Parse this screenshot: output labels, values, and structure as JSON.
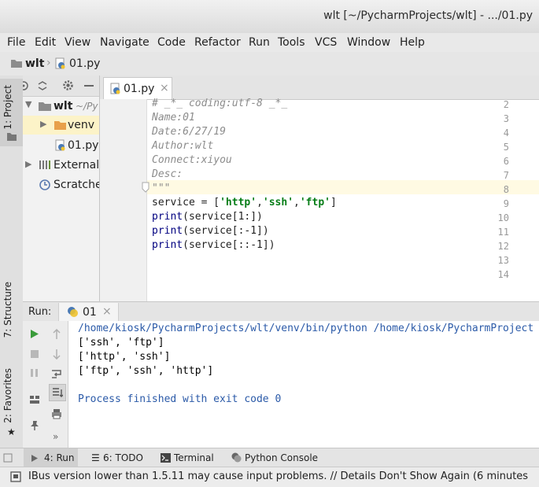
{
  "window": {
    "title": "wlt [~/PycharmProjects/wlt] - .../01.py"
  },
  "menu": [
    "File",
    "Edit",
    "View",
    "Navigate",
    "Code",
    "Refactor",
    "Run",
    "Tools",
    "VCS",
    "Window",
    "Help"
  ],
  "breadcrumb": {
    "project": "wlt",
    "file": "01.py"
  },
  "side_tabs": {
    "project": "1: Project",
    "structure": "7: Structure",
    "favorites": "2: Favorites"
  },
  "project_tree": {
    "root": "wlt",
    "root_path": "~/Py",
    "items": [
      "venv",
      "01.py",
      "External",
      "Scratche"
    ]
  },
  "editor": {
    "tab": "01.py",
    "tab_close": "×",
    "lines": [
      {
        "n": "2",
        "text": "# _*_ coding:utf-8 _*_",
        "kind": "comment"
      },
      {
        "n": "3",
        "text": "Name:01",
        "kind": "comment"
      },
      {
        "n": "4",
        "text": "Date:6/27/19",
        "kind": "comment"
      },
      {
        "n": "5",
        "text": "Author:wlt",
        "kind": "comment"
      },
      {
        "n": "6",
        "text": "Connect:xiyou",
        "kind": "comment"
      },
      {
        "n": "7",
        "text": "Desc:",
        "kind": "comment"
      },
      {
        "n": "8",
        "text": "\"\"\"",
        "kind": "comment"
      },
      {
        "n": "9",
        "text": "service = ['http','ssh','ftp']",
        "kind": "code"
      },
      {
        "n": "10",
        "text": "print(service[1:])",
        "kind": "code"
      },
      {
        "n": "11",
        "text": "print(service[:-1])",
        "kind": "code"
      },
      {
        "n": "12",
        "text": "print(service[::-1])",
        "kind": "code"
      },
      {
        "n": "13",
        "text": "",
        "kind": "code"
      },
      {
        "n": "14",
        "text": "",
        "kind": "code"
      }
    ]
  },
  "run": {
    "label": "Run:",
    "tab": "01",
    "tab_close": "×",
    "output": [
      "/home/kiosk/PycharmProjects/wlt/venv/bin/python /home/kiosk/PycharmProject",
      "['ssh', 'ftp']",
      "['http', 'ssh']",
      "['ftp', 'ssh', 'http']",
      "",
      "Process finished with exit code 0"
    ]
  },
  "bottom_tabs": [
    "4: Run",
    "6: TODO",
    "Terminal",
    "Python Console"
  ],
  "status": {
    "message": "IBus version lower than 1.5.11 may cause input problems. // Details Don't Show Again (6 minutes"
  },
  "colors": {
    "accent": "#2b5aa8",
    "caret_line": "#fffae3",
    "run_green": "#3a9b3a",
    "folder": "#e8a04a"
  }
}
